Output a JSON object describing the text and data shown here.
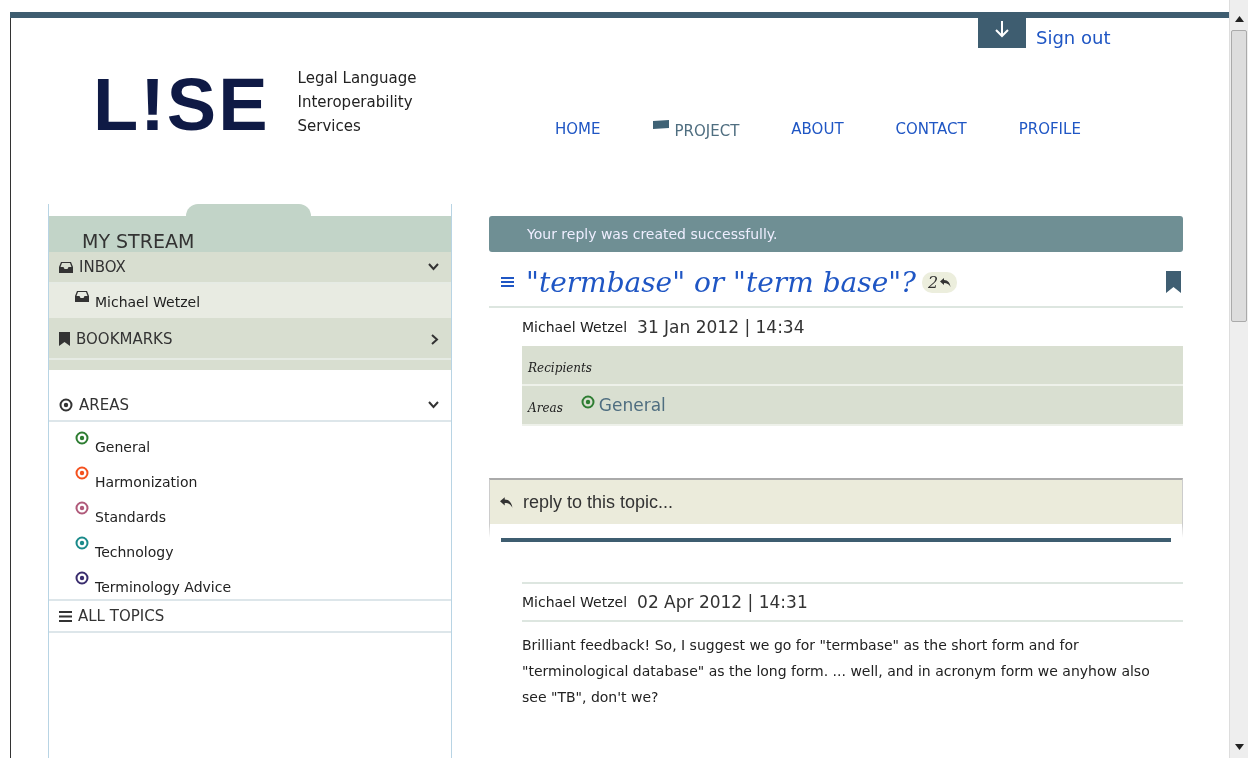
{
  "header": {
    "logo": "L!SE",
    "tagline": [
      "Legal Language",
      "Interoperability",
      "Services"
    ],
    "sign_out": "Sign out"
  },
  "nav": [
    {
      "label": "HOME",
      "selected": false
    },
    {
      "label": "PROJECT",
      "selected": true
    },
    {
      "label": "ABOUT",
      "selected": false
    },
    {
      "label": "CONTACT",
      "selected": false
    },
    {
      "label": "PROFILE",
      "selected": false
    }
  ],
  "sidebar": {
    "title": "MY STREAM",
    "sections": [
      {
        "kind": "inbox",
        "label": "INBOX",
        "expanded": true,
        "items": [
          {
            "label": "Michael Wetzel",
            "selected": true
          }
        ]
      },
      {
        "kind": "bookmarks",
        "label": "BOOKMARKS",
        "expanded": false
      },
      {
        "kind": "areas",
        "label": "AREAS",
        "expanded": true,
        "items": [
          {
            "label": "General",
            "color": "#2e7d32",
            "selected": false
          },
          {
            "label": "Harmonization",
            "color": "#f4511e",
            "selected": false
          },
          {
            "label": "Standards",
            "color": "#b05a7a",
            "selected": false
          },
          {
            "label": "Technology",
            "color": "#1a8a8a",
            "selected": false
          },
          {
            "label": "Terminology Advice",
            "color": "#3a2d6e",
            "selected": false
          }
        ]
      },
      {
        "kind": "all",
        "label": "ALL TOPICS"
      }
    ]
  },
  "flash": "Your reply was created successfully.",
  "topic": {
    "title": "\"termbase\" or \"term base\"?",
    "reply_count": "2",
    "author": "Michael Wetzel",
    "date": "31 Jan 2012 | 14:34",
    "recipients_label": "Recipients",
    "areas_label": "Areas",
    "area": {
      "label": "General",
      "color": "#2e7d32"
    }
  },
  "reply_prompt": "reply to this topic...",
  "replies": [
    {
      "author": "Michael Wetzel",
      "date": "02 Apr 2012 | 14:31",
      "text": "Brilliant feedback! So, I suggest we go for \"termbase\" as the short form and for \"terminological database\" as the long form. ... well, and in acronym form we anyhow also see \"TB\", don't we?"
    }
  ]
}
